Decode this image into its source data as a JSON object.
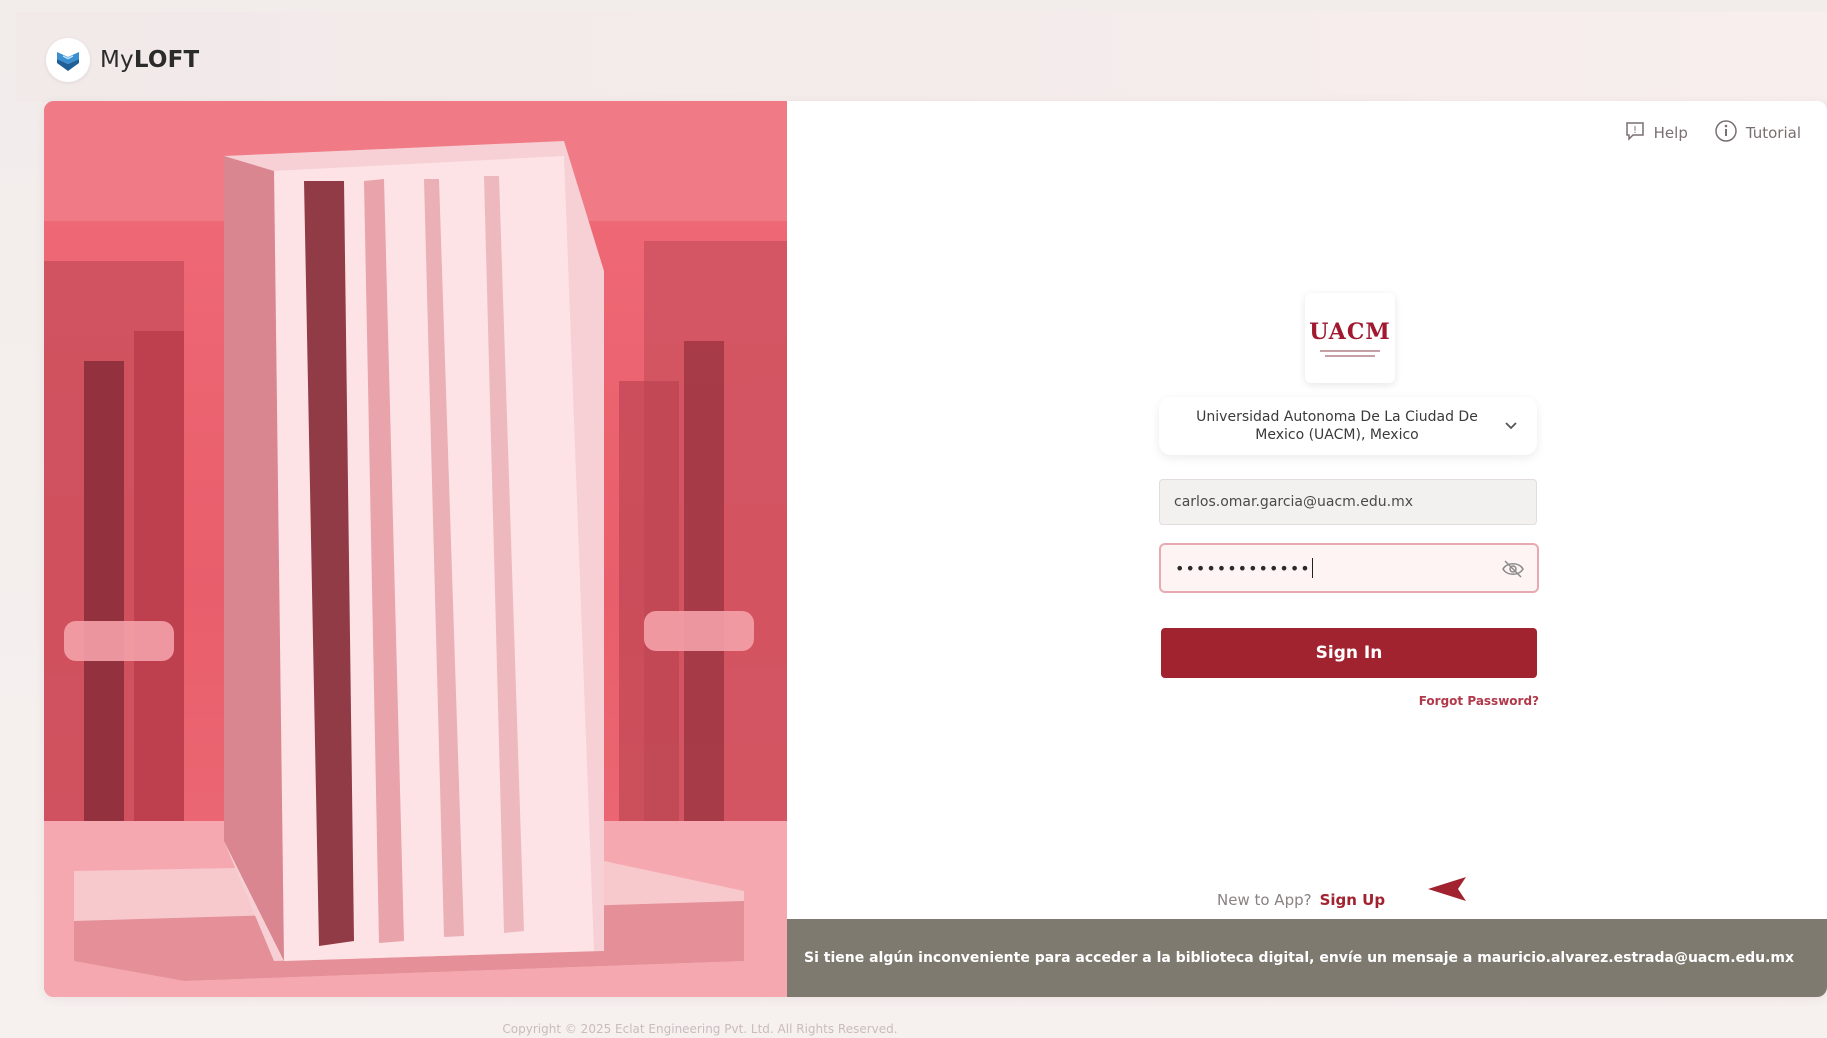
{
  "brand": {
    "name_regular": "My",
    "name_bold": "LOFT",
    "logo_icon": "shield-book-icon"
  },
  "header_links": [
    {
      "label": "Help",
      "icon": "help-icon"
    },
    {
      "label": "Tutorial",
      "icon": "info-icon"
    }
  ],
  "institution": {
    "logo_text": "UACM",
    "selected": "Universidad Autonoma De La Ciudad De Mexico (UACM), Mexico"
  },
  "login": {
    "email_value": "carlos.omar.garcia@uacm.edu.mx",
    "password_masked": "•••••••••••••",
    "signin_label": "Sign In",
    "forgot_label": "Forgot Password?",
    "new_to_app": "New to App?",
    "signup_label": "Sign Up"
  },
  "notice": {
    "text": "Si tiene algún inconveniente para acceder a la biblioteca digital, envíe un mensaje a mauricio.alvarez.estrada@uacm.edu.mx"
  },
  "footer": {
    "copyright": "Copyright © 2025 Eclat Engineering Pvt. Ltd. All Rights Reserved."
  },
  "colors": {
    "primary": "#a1232f",
    "hero_tint": "#ec6d78",
    "notice_bg": "#7f7a70"
  }
}
